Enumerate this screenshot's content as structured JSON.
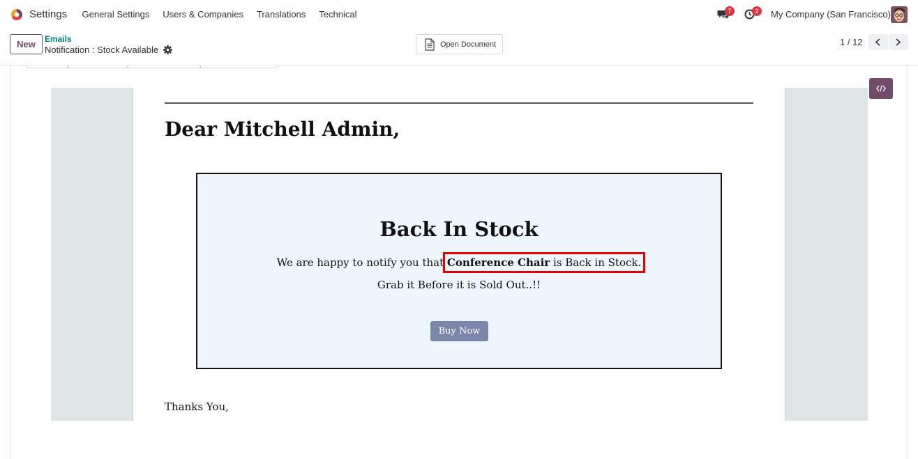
{
  "navbar": {
    "app_name": "Settings",
    "menu": [
      {
        "label": "General Settings"
      },
      {
        "label": "Users & Companies"
      },
      {
        "label": "Translations"
      },
      {
        "label": "Technical"
      }
    ],
    "messages_count": "7",
    "activities_count": "2",
    "company": "My Company (San Francisco)",
    "icons": {
      "logo": "odoo-logo-icon",
      "messages": "chat-icon",
      "activities": "clock-icon",
      "avatar": "user-avatar"
    }
  },
  "control_panel": {
    "new_label": "New",
    "breadcrumb_parent": "Emails",
    "breadcrumb_current": "Notification : Stock Available",
    "open_document_label": "Open Document",
    "pager": "1 / 12"
  },
  "email": {
    "greeting": "Dear Mitchell Admin,",
    "box_title": "Back In Stock",
    "notify_prefix": "We are happy to notify you that ",
    "product_name": "Conference Chair",
    "notify_suffix": " is Back in Stock.",
    "grab_line": "Grab it Before it is Sold Out..!!",
    "buy_button": "Buy Now",
    "thanks": "Thanks You,"
  },
  "colors": {
    "brand": "#714b67",
    "link": "#017e84",
    "badge": "#dc3545",
    "highlight": "#e00000",
    "buy_button": "#7c86ab",
    "box_bg": "#eef6fd"
  }
}
